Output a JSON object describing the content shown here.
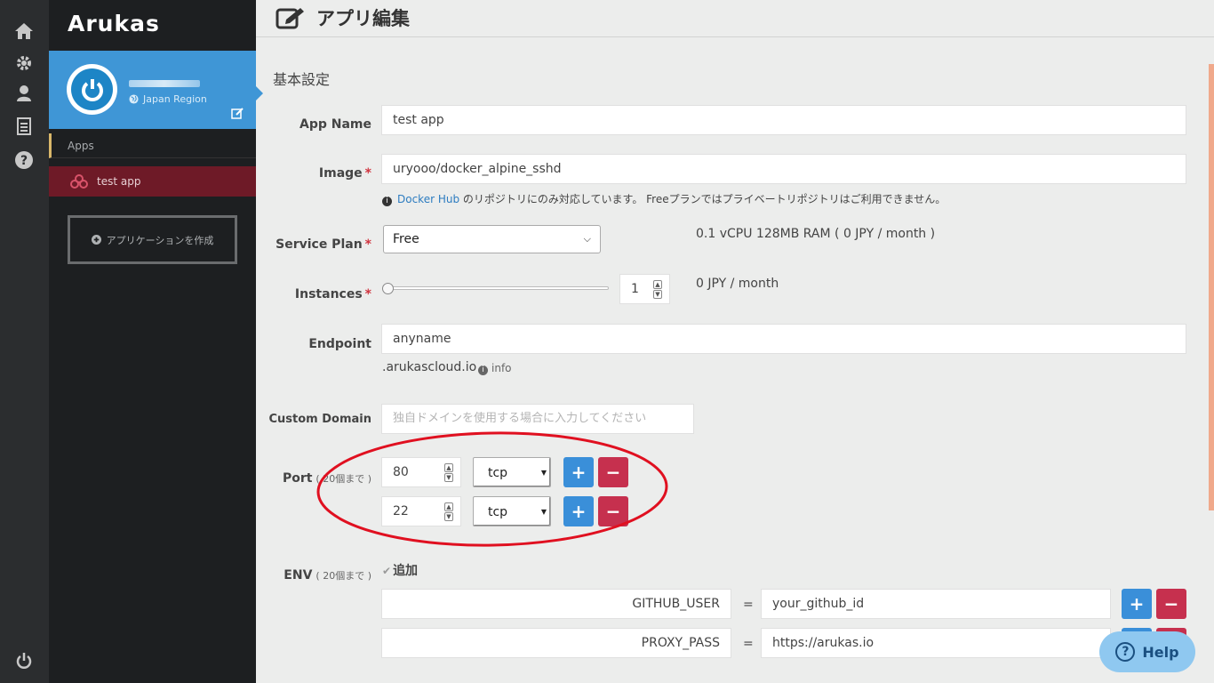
{
  "rail": {
    "home_icon": "home-icon",
    "settings_icon": "gear-icon",
    "user_icon": "user-icon",
    "doc_icon": "document-icon",
    "help_icon": "question-icon",
    "power_icon": "power-icon"
  },
  "sidebar": {
    "logo": "Arukas",
    "region": "Japan Region",
    "apps_heading": "Apps",
    "app_item": "test app",
    "create_button": "アプリケーションを作成"
  },
  "header": {
    "title": "アプリ編集"
  },
  "form": {
    "section_title": "基本設定",
    "app_name_label": "App Name",
    "app_name_value": "test app",
    "image_label": "Image",
    "image_value": "uryooo/docker_alpine_sshd",
    "image_note_link": "Docker Hub",
    "image_note_text": " のリポジトリにのみ対応しています。 Freeプランではプライベートリポジトリはご利用できません。",
    "service_plan_label": "Service Plan",
    "service_plan_value": "Free",
    "service_plan_info": "0.1 vCPU 128MB RAM ( 0 JPY / month )",
    "instances_label": "Instances",
    "instances_value": "1",
    "instances_price": "0 JPY / month",
    "endpoint_label": "Endpoint",
    "endpoint_value": "anyname",
    "endpoint_suffix": ".arukascloud.io",
    "endpoint_info": "info",
    "custom_domain_label": "Custom Domain",
    "custom_domain_placeholder": "独自ドメインを使用する場合に入力してください",
    "port_label": "Port",
    "port_sub": "( 20個まで )",
    "ports": [
      {
        "number": "80",
        "protocol": "tcp"
      },
      {
        "number": "22",
        "protocol": "tcp"
      }
    ],
    "env_label": "ENV",
    "env_sub": "( 20個まで )",
    "env_add": "追加",
    "env": [
      {
        "key": "GITHUB_USER",
        "eq": "=",
        "value": "your_github_id"
      },
      {
        "key": "PROXY_PASS",
        "eq": "=",
        "value": "https://arukas.io"
      }
    ],
    "plus": "+",
    "minus": "−"
  },
  "help_button": "Help",
  "colors": {
    "annotation": "#e01020",
    "accent": "#3a8fd9",
    "danger": "#c6304e"
  }
}
